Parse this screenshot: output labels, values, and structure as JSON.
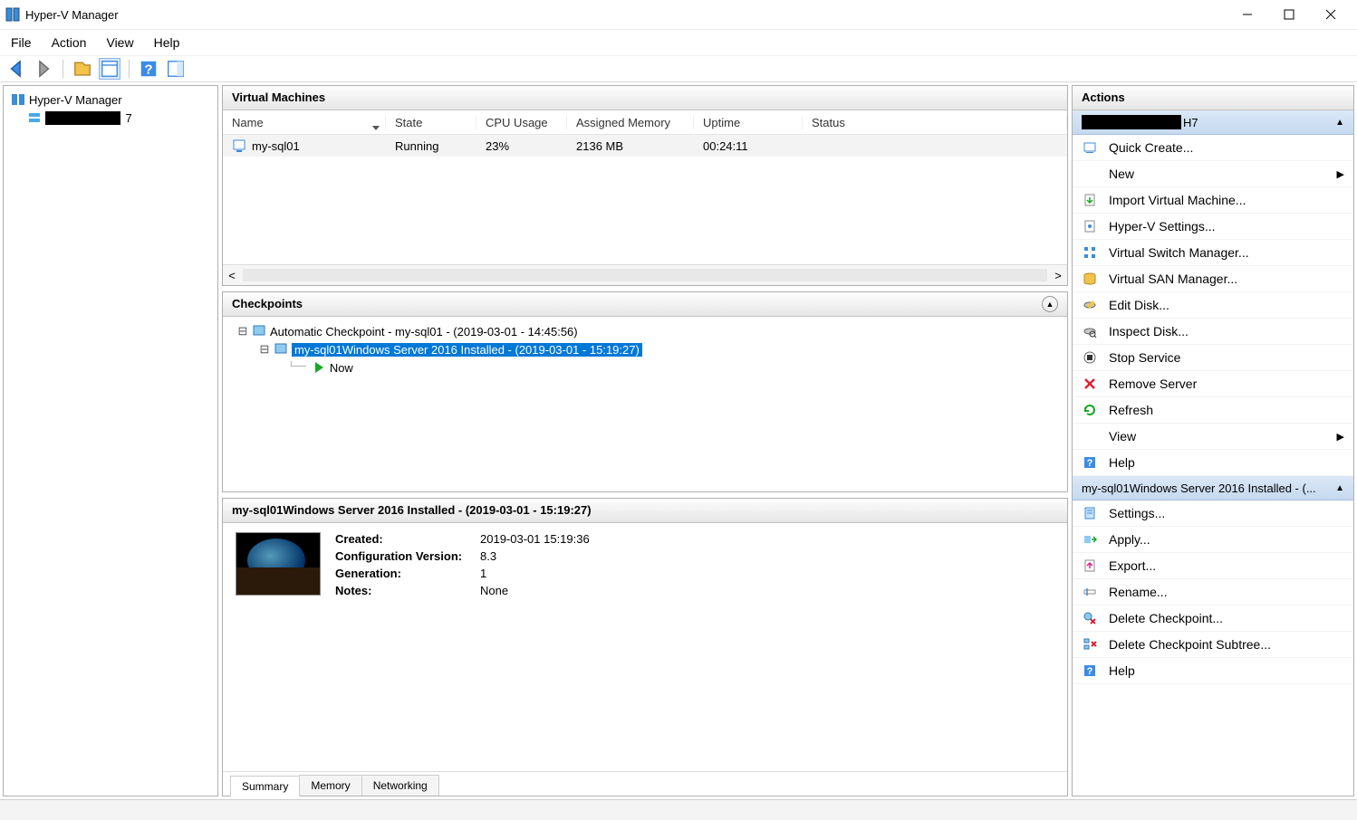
{
  "window": {
    "title": "Hyper-V Manager"
  },
  "menu": [
    "File",
    "Action",
    "View",
    "Help"
  ],
  "tree": {
    "root": "Hyper-V Manager",
    "host_suffix": "7"
  },
  "vm_section": {
    "title": "Virtual Machines",
    "columns": [
      "Name",
      "State",
      "CPU Usage",
      "Assigned Memory",
      "Uptime",
      "Status"
    ],
    "rows": [
      {
        "name": "my-sql01",
        "state": "Running",
        "cpu": "23%",
        "mem": "2136 MB",
        "uptime": "00:24:11",
        "status": ""
      }
    ]
  },
  "checkpoints": {
    "title": "Checkpoints",
    "tree": {
      "l0": "Automatic Checkpoint - my-sql01 - (2019-03-01 - 14:45:56)",
      "l1": "my-sql01Windows Server 2016 Installed - (2019-03-01 - 15:19:27)",
      "l2": "Now"
    }
  },
  "detail": {
    "title": "my-sql01Windows Server 2016 Installed - (2019-03-01 - 15:19:27)",
    "rows": [
      {
        "k": "Created:",
        "v": "2019-03-01 15:19:36"
      },
      {
        "k": "Configuration Version:",
        "v": "8.3"
      },
      {
        "k": "Generation:",
        "v": "1"
      },
      {
        "k": "Notes:",
        "v": "None"
      }
    ],
    "tabs": [
      "Summary",
      "Memory",
      "Networking"
    ]
  },
  "actions": {
    "header": "Actions",
    "host_suffix": "H7",
    "host_items": [
      {
        "icon": "quick-create",
        "label": "Quick Create..."
      },
      {
        "icon": "blank",
        "label": "New",
        "sub": true
      },
      {
        "icon": "import",
        "label": "Import Virtual Machine..."
      },
      {
        "icon": "settings",
        "label": "Hyper-V Settings..."
      },
      {
        "icon": "vswitch",
        "label": "Virtual Switch Manager..."
      },
      {
        "icon": "vsan",
        "label": "Virtual SAN Manager..."
      },
      {
        "icon": "edit-disk",
        "label": "Edit Disk..."
      },
      {
        "icon": "inspect-disk",
        "label": "Inspect Disk..."
      },
      {
        "icon": "stop",
        "label": "Stop Service"
      },
      {
        "icon": "remove",
        "label": "Remove Server"
      },
      {
        "icon": "refresh",
        "label": "Refresh"
      },
      {
        "icon": "blank",
        "label": "View",
        "sub": true
      },
      {
        "icon": "help",
        "label": "Help"
      }
    ],
    "ck_title": "my-sql01Windows Server 2016 Installed - (...",
    "ck_items": [
      {
        "icon": "settings2",
        "label": "Settings..."
      },
      {
        "icon": "apply",
        "label": "Apply..."
      },
      {
        "icon": "export",
        "label": "Export..."
      },
      {
        "icon": "rename",
        "label": "Rename..."
      },
      {
        "icon": "del-ck",
        "label": "Delete Checkpoint..."
      },
      {
        "icon": "del-tree",
        "label": "Delete Checkpoint Subtree..."
      },
      {
        "icon": "help",
        "label": "Help"
      }
    ]
  }
}
